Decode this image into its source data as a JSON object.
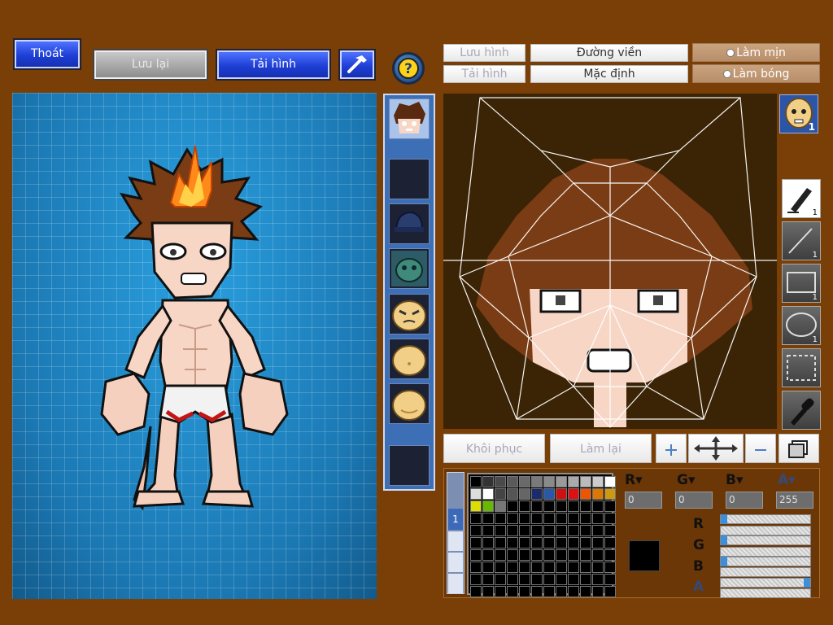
{
  "top_left": {
    "exit_label": "Thoát",
    "save_label": "Lưu lại",
    "load_label": "Tải hình"
  },
  "top_right": {
    "save_image_label": "Lưu hình",
    "load_image_label": "Tải hình",
    "outline_label": "Đường viền",
    "default_label": "Mặc định",
    "smooth_label": "Làm mịn",
    "shade_label": "Làm bóng"
  },
  "icons": {
    "hammer": "hammer-icon",
    "help": "help-icon",
    "pen": "pen-icon",
    "line": "line-icon",
    "rect": "rectangle-icon",
    "ellipse": "ellipse-icon",
    "select": "selection-icon",
    "picker": "eyedropper-icon"
  },
  "face_badge_number": "1",
  "tools": [
    {
      "name": "pen",
      "count": "1"
    },
    {
      "name": "line",
      "count": "1"
    },
    {
      "name": "rectangle",
      "count": "1"
    },
    {
      "name": "ellipse",
      "count": "1"
    },
    {
      "name": "selection",
      "count": ""
    },
    {
      "name": "eyedropper",
      "count": ""
    }
  ],
  "edit_buttons": {
    "restore_label": "Khôi phục",
    "redo_label": "Làm lại"
  },
  "palette": {
    "tab_label": "1",
    "colors": [
      "#000000",
      "#333333",
      "#4a4a4a",
      "#5a5a5a",
      "#6a6a6a",
      "#7a7a7a",
      "#8a8a8a",
      "#9a9a9a",
      "#aaaaaa",
      "#bbbbbb",
      "#cccccc",
      "#ffffff",
      "#dddddd",
      "#ffffff",
      "#444444",
      "#555555",
      "#666666",
      "#1a2a6a",
      "#2b58a6",
      "#cc1111",
      "#dd1111",
      "#ee5500",
      "#dd7700",
      "#cc9911",
      "#dddd00",
      "#66bb00",
      "#777777"
    ],
    "grid_rows": 10,
    "grid_cols": 12
  },
  "channels": {
    "r_value": "0",
    "g_value": "0",
    "b_value": "0",
    "a_value": "255",
    "sliders": [
      0.0,
      0.0,
      0.0,
      1.0
    ]
  },
  "colors": {
    "background": "#7a3f07",
    "canvas": "#1f86c2",
    "face_panel": "#3b2406",
    "current_color": "#000000"
  }
}
